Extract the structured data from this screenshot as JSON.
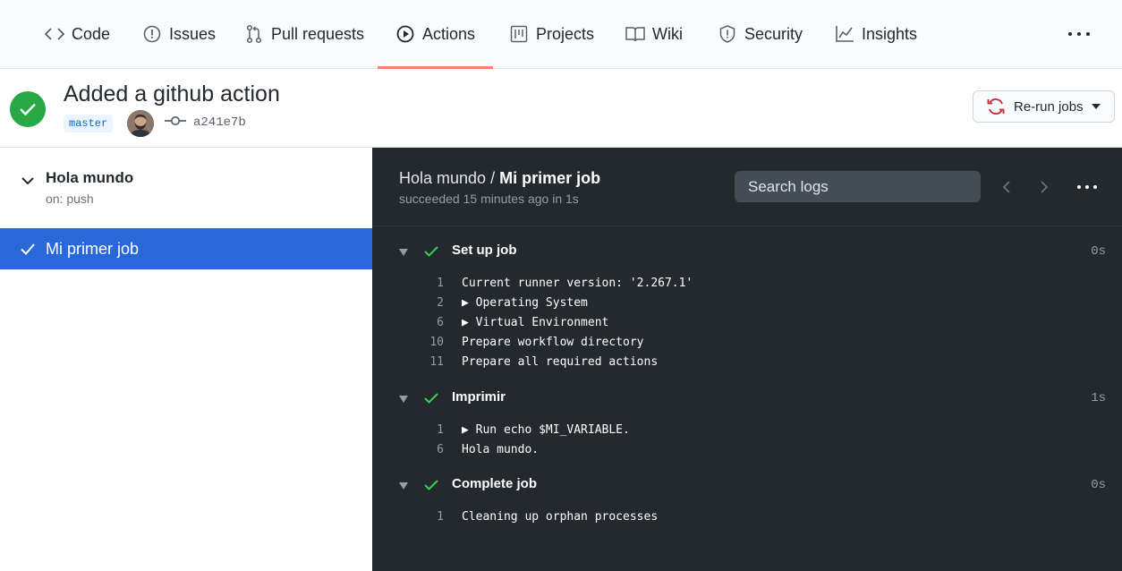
{
  "nav": {
    "tabs": [
      {
        "label": "Code",
        "icon": "code-icon"
      },
      {
        "label": "Issues",
        "icon": "issue-icon"
      },
      {
        "label": "Pull requests",
        "icon": "pull-request-icon"
      },
      {
        "label": "Actions",
        "icon": "play-icon",
        "active": true
      },
      {
        "label": "Projects",
        "icon": "project-icon"
      },
      {
        "label": "Wiki",
        "icon": "book-icon"
      },
      {
        "label": "Security",
        "icon": "shield-icon"
      },
      {
        "label": "Insights",
        "icon": "graph-icon"
      }
    ],
    "active_underline_color": "#f9826c"
  },
  "run": {
    "title": "Added a github action",
    "branch": "master",
    "sha": "a241e7b",
    "status": "success",
    "rerun_label": "Re-run jobs"
  },
  "sidebar": {
    "workflow_name": "Hola mundo",
    "workflow_trigger": "on: push",
    "selected_job": "Mi primer job"
  },
  "logs": {
    "crumb_workflow": "Hola mundo",
    "crumb_sep": " / ",
    "crumb_job": "Mi primer job",
    "meta": "succeeded 15 minutes ago in 1s",
    "search_placeholder": "Search logs",
    "steps": [
      {
        "name": "Set up job",
        "time": "0s",
        "lines": [
          {
            "n": "1",
            "text": "Current runner version: '2.267.1'"
          },
          {
            "n": "2",
            "text": "▶ Operating System"
          },
          {
            "n": "6",
            "text": "▶ Virtual Environment"
          },
          {
            "n": "10",
            "text": "Prepare workflow directory"
          },
          {
            "n": "11",
            "text": "Prepare all required actions"
          }
        ]
      },
      {
        "name": "Imprimir",
        "time": "1s",
        "lines": [
          {
            "n": "1",
            "text": "▶ Run echo $MI_VARIABLE."
          },
          {
            "n": "6",
            "text": "Hola mundo."
          }
        ]
      },
      {
        "name": "Complete job",
        "time": "0s",
        "lines": [
          {
            "n": "1",
            "text": "Cleaning up orphan processes"
          }
        ]
      }
    ]
  },
  "colors": {
    "success": "#28a745",
    "selected_bg": "#2a67d8",
    "log_bg": "#24292e"
  }
}
